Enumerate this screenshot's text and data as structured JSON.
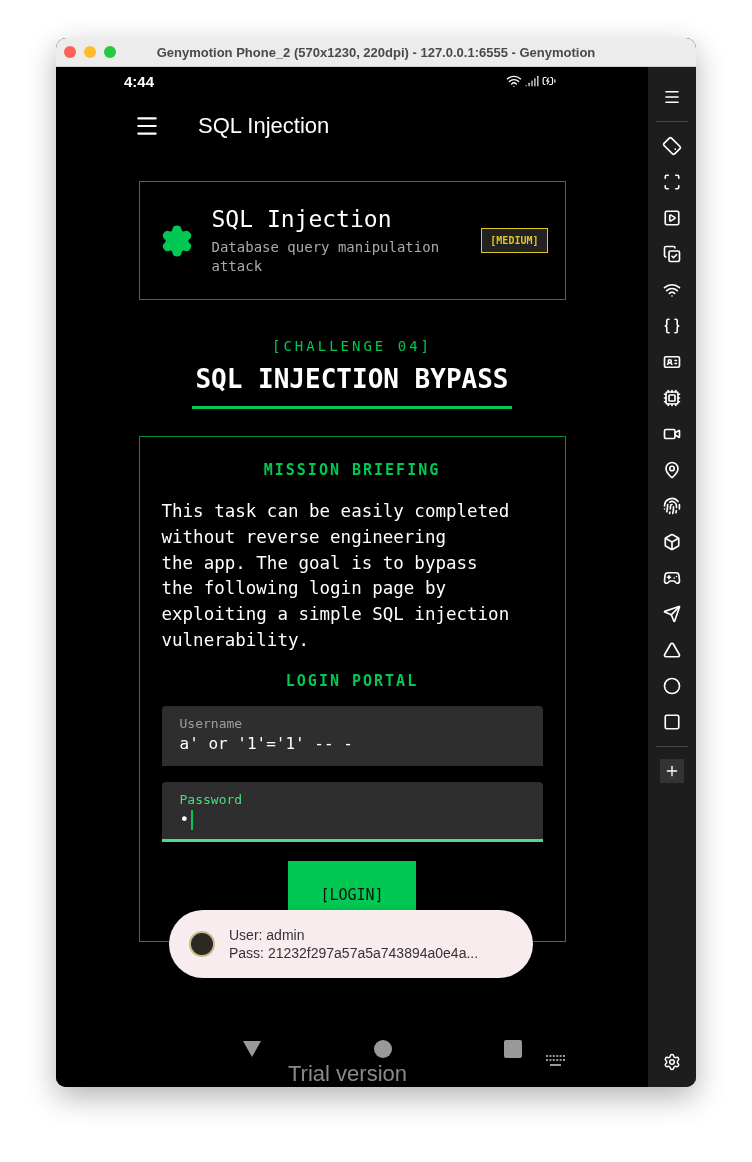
{
  "window": {
    "title": "Genymotion Phone_2 (570x1230, 220dpi) - 127.0.0.1:6555 - Genymotion"
  },
  "status_bar": {
    "time": "4:44"
  },
  "app_bar": {
    "title": "SQL Injection"
  },
  "category_card": {
    "title": "SQL Injection",
    "subtitle": "Database query manipulation attack",
    "badge": "[MEDIUM]"
  },
  "challenge": {
    "label": "[CHALLENGE 04]",
    "title": "SQL INJECTION BYPASS"
  },
  "mission": {
    "heading": "MISSION BRIEFING",
    "text": "This task can be easily completed\nwithout reverse engineering\nthe app. The goal is to bypass\nthe following login page by\nexploiting a simple SQL injection\nvulnerability.",
    "portal_heading": "LOGIN PORTAL",
    "fields": [
      {
        "label": "Username",
        "value": "a' or '1'='1' -- -",
        "focused": false
      },
      {
        "label": "Password",
        "value": "•",
        "focused": true
      }
    ],
    "button": "[LOGIN]"
  },
  "toast": {
    "lines": [
      "User: admin",
      "Pass: 21232f297a57a5a743894a0e4a..."
    ]
  },
  "overlay": {
    "text": "Trial version"
  },
  "toolbar": {
    "items": [
      {
        "kind": "menu"
      },
      {
        "kind": "divider"
      },
      {
        "kind": "rotate"
      },
      {
        "kind": "scale"
      },
      {
        "kind": "capture"
      },
      {
        "kind": "clipboard"
      },
      {
        "kind": "wifi"
      },
      {
        "kind": "braces"
      },
      {
        "kind": "id"
      },
      {
        "kind": "sim"
      },
      {
        "kind": "camera"
      },
      {
        "kind": "location"
      },
      {
        "kind": "fingerprint"
      },
      {
        "kind": "motion"
      },
      {
        "kind": "gamepad"
      },
      {
        "kind": "cast"
      },
      {
        "kind": "back"
      },
      {
        "kind": "home"
      },
      {
        "kind": "recents"
      },
      {
        "kind": "divider"
      },
      {
        "kind": "add"
      }
    ]
  }
}
